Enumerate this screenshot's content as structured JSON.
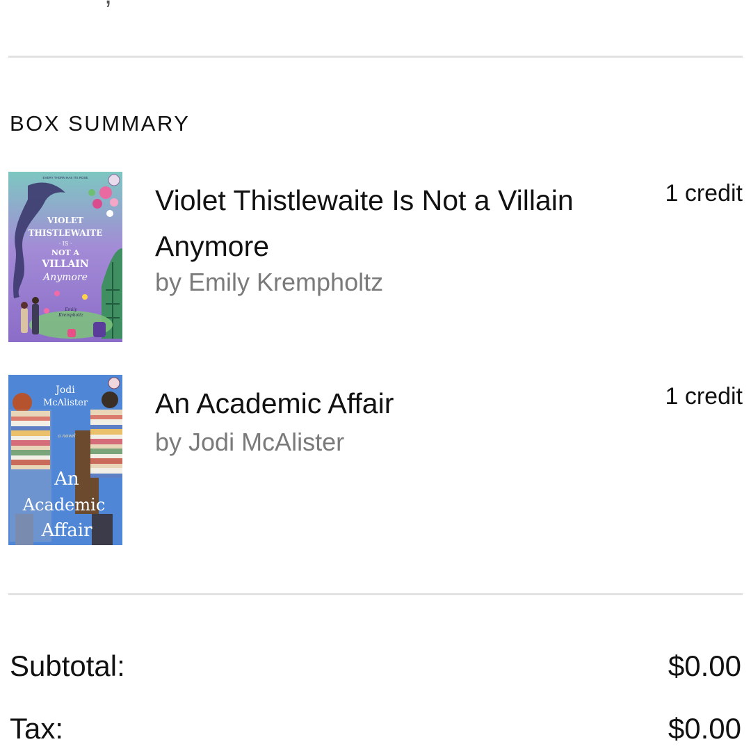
{
  "section_heading": "BOX SUMMARY",
  "books": [
    {
      "title": "Violet Thistlewaite Is Not a Villain Anymore",
      "author": "by Emily Krempholtz",
      "credit": "1 credit",
      "cover": {
        "top_banner": "EVERY THORN HAS ITS ROSE",
        "line1": "VIOLET",
        "line2": "THISTLEWAITE",
        "line3": "· IS ·",
        "line4": "NOT A",
        "line5": "VILLAIN",
        "line6": "Anymore",
        "author_line1": "Emily",
        "author_line2": "Krempholtz"
      }
    },
    {
      "title": "An Academic Affair",
      "author": "by Jodi McAlister",
      "credit": "1 credit",
      "cover": {
        "author_line1": "Jodi",
        "author_line2": "McAlister",
        "tag": "a novel",
        "title_line1": "An",
        "title_line2": "Academic",
        "title_line3": "Affair"
      }
    }
  ],
  "totals": {
    "subtotal_label": "Subtotal:",
    "subtotal_value": "$0.00",
    "tax_label": "Tax:",
    "tax_value": "$0.00"
  },
  "colors": {
    "divider": "#e2e2e2",
    "author_text": "#7a7a7a",
    "cover1_bg": "#9c7fd0",
    "cover2_bg": "#4f86d6"
  }
}
